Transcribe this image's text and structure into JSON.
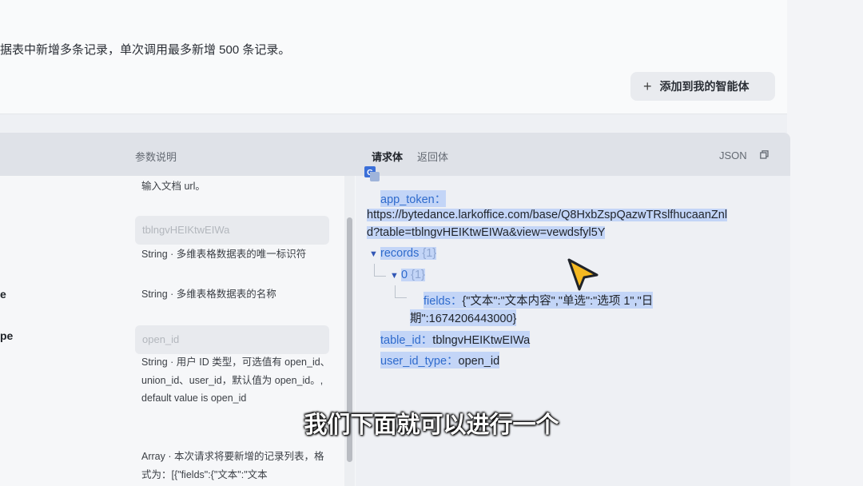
{
  "header": {
    "description": "据表中新增多条记录，单次调用最多新增 500 条记录。",
    "add_button_label": "添加到我的智能体"
  },
  "panel": {
    "param_desc_header": "参数说明",
    "tabs": [
      {
        "label": "请求体",
        "active": true
      },
      {
        "label": "返回体",
        "active": false
      }
    ],
    "json_label": "JSON"
  },
  "params": [
    {
      "name": "",
      "desc": "输入文档 url。"
    },
    {
      "name": "",
      "input_value": "tblngvHEIKtwEIWa",
      "desc": "String · 多维表格数据表的唯一标识符"
    },
    {
      "name": "e",
      "desc": "String · 多维表格数据表的名称"
    },
    {
      "name": "pe",
      "input_value": "open_id",
      "desc": "String · 用户 ID 类型，可选值有 open_id、union_id、user_id，默认值为 open_id。, default value is open_id"
    },
    {
      "name": "",
      "desc": "Array · 本次请求将要新增的记录列表，格式为：[{\"fields\":{\"文本\":\"文本"
    }
  ],
  "code": {
    "app_token_key": "app_token",
    "sep": "：",
    "app_token_line1": "https://bytedance.larkoffice.com/base/Q8HxbZspQazwTRslfhucaanZnl",
    "app_token_line2": "d?table=tblngvHEIKtwEIWa&view=vewdsfyl5Y",
    "records_key": "records",
    "records_count": "{1}",
    "item_key": "0",
    "item_count": "{1}",
    "fields_key": "fields",
    "fields_line1": "{\"文本\":\"文本内容\",\"单选\":\"选项 1\",\"日",
    "fields_line2": "期\":1674206443000}",
    "table_id_key": "table_id",
    "table_id_value": "tblngvHEIKtwEIWa",
    "user_id_type_key": "user_id_type",
    "user_id_type_value": "open_id"
  },
  "subtitle": "我们下面就可以进行一个",
  "colors": {
    "highlight": "#c3d5f7",
    "key": "#2f6bcc",
    "cursor": "#f5b921"
  }
}
